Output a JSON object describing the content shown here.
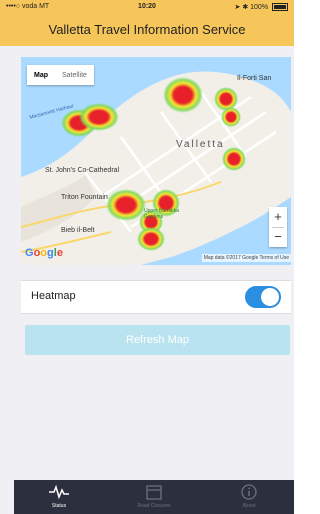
{
  "status_bar": {
    "carrier": "••••○ voda MT",
    "time": "10:20",
    "battery": "100%"
  },
  "header": {
    "title": "Valletta Travel Information Service"
  },
  "map": {
    "type_control": {
      "map": "Map",
      "satellite": "Satellite",
      "selected": "Map"
    },
    "labels": {
      "valletta": "Valletta",
      "cathedral": "St. John's Co-Cathedral",
      "triton": "Triton Fountain",
      "bieb": "Bieb il-Belt",
      "fort": "Il-Forti San",
      "barrakka": "Upper Barrakka Gardens",
      "marsamxett": "Marsamxett Harbour"
    },
    "zoom": {
      "in": "+",
      "out": "−"
    },
    "attribution": "Map data ©2017 Google  Terms of Use",
    "heat_colors": {
      "hot": "#e8202a",
      "warm": "#f4e330",
      "cool": "#7ed957"
    }
  },
  "heatmap_row": {
    "label": "Heatmap",
    "enabled": true,
    "accent": "#2a8fe0"
  },
  "refresh_button": {
    "label": "Refresh Map"
  },
  "tabbar": {
    "tabs": [
      {
        "label": "Status",
        "icon": "pulse-icon",
        "active": true
      },
      {
        "label": "Road Closures",
        "icon": "calendar-icon",
        "active": false
      },
      {
        "label": "About",
        "icon": "info-icon",
        "active": false
      }
    ]
  }
}
